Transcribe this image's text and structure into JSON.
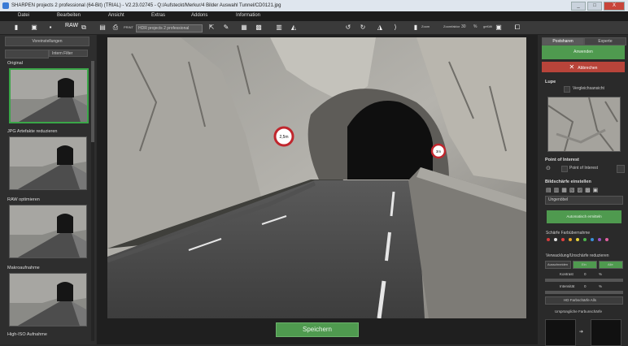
{
  "window": {
    "title": "SHARPEN projects 2 professional (64-Bit) (TRIAL) - V2.23.02745 - Q:/Aufsteckt/Merkur/4 Bilder Auswahl Tunnel/CD0121.jpg",
    "buttons": [
      "_",
      "□",
      "X"
    ]
  },
  "menu": [
    "Datei",
    "Bearbeiten",
    "Ansicht",
    "Extras",
    "Addons",
    "Information"
  ],
  "toolbar": {
    "raw_label": "RAW",
    "print_label": "PRINT",
    "select_value": "HDR projects 2 professional",
    "zoom_label": "Zoom",
    "zoomfaktor_label": "Zoomfaktor",
    "zoom_value": "30",
    "zoom_unit": "%",
    "fit_label": "gefüllt"
  },
  "left": {
    "head_label": "Voreinstellungen",
    "filter_label": "Intern Filter",
    "presets": [
      {
        "label": "Original"
      },
      {
        "label": "JPG Artefakte reduzieren"
      },
      {
        "label": "RAW optimieren"
      },
      {
        "label": "Makroaufnahme"
      },
      {
        "label": "High-ISO Aufnahme"
      }
    ]
  },
  "main": {
    "save_label": "Speichern",
    "sign1": "2,5m",
    "sign2": "3m"
  },
  "right": {
    "tab1": "Postsharen",
    "tab2": "Experte",
    "apply_label": "Anwenden",
    "cancel_label": "Abbrechen",
    "lupe_label": "Lupe",
    "lupe_option": "Vergleichsansicht",
    "poi_label": "Point of Interest",
    "poi_option": "Point of Interest",
    "sharp_label": "Bildschärfe einstellen",
    "sharp_select": "Ungenöbel",
    "auto_button": "Automatisch ermitteln",
    "color_label": "Schärfe Farbübernahme",
    "colors": [
      "#d23c3c",
      "#e0e0e0",
      "#e04040",
      "#e6a02a",
      "#e6d23a",
      "#4bb34b",
      "#3a8fd8",
      "#9a50c8",
      "#e060a0"
    ],
    "noise_label": "Verwacklung/Unschärfe reduzieren",
    "noise_b1": "Ausschneiden",
    "noise_b2": "Ein",
    "noise_b3": "Alle",
    "kontrast_label": "Kontrast",
    "kontrast_value": "0",
    "unit": "%",
    "intensitaet_label": "Intensität",
    "intensitaet_value": "0",
    "hd_label": "HD Farbschärfe Alls",
    "compare_label": "Ursprüngliche Farbunschärfe"
  }
}
